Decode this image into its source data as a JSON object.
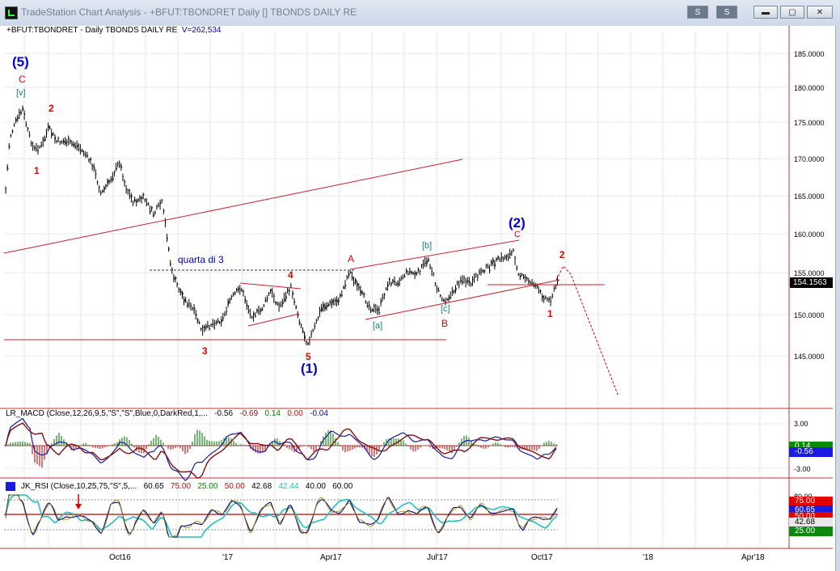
{
  "window": {
    "title": "TradeStation Chart Analysis - +BFUT:TBONDRET Daily [] TBONDS DAILY RE",
    "buttons": {
      "s_label": "S",
      "min_label": "▬",
      "max_label": "▢",
      "close_label": "✕"
    }
  },
  "chart": {
    "symbol_line": "+BFUT:TBONDRET - Daily  TBONDS DAILY RE",
    "v_value": "V=262,534",
    "last_price": "154.1563",
    "price_ticks": [
      "185.0000",
      "180.0000",
      "175.0000",
      "170.0000",
      "165.0000",
      "160.0000",
      "155.0000",
      "150.0000",
      "145.0000"
    ],
    "x_ticks": [
      "Oct16",
      "'17",
      "Apr17",
      "Jul'17",
      "Oct17",
      "'18",
      "Apr'18"
    ],
    "annotations": {
      "w5_blue": "(5)",
      "c_red_top": "C",
      "v_teal": "[v]",
      "two_red_top": "2",
      "one_red_top": "1",
      "quarta": "quarta di 3",
      "three_red": "3",
      "four_red": "4",
      "five_red": "5",
      "w1_blue": "(1)",
      "a_red": "A",
      "a_teal": "[a]",
      "b_teal": "[b]",
      "c_teal": "[c]",
      "b_red": "B",
      "w2_blue": "(2)",
      "c_red_mid": "C",
      "two_red_right": "2",
      "one_red_right": "1"
    },
    "colors": {
      "accent_blue": "#0000d0",
      "wave_red": "#e00000",
      "wave_teal": "#177e7e",
      "bars": "#000000",
      "channel": "#c8202a"
    }
  },
  "macd": {
    "label": "LR_MACD (Close,12,26,9,5,\"S\",\"S\",Blue,0,DarkRed,1,...",
    "values": {
      "v1": "-0.56",
      "v2": "-0.69",
      "v3": "0.14",
      "v4": "0.00",
      "v5": "-0.04"
    },
    "ticks": [
      "3.00",
      "-3.00"
    ],
    "badges": {
      "b1": "0.14",
      "b2": "-0.56"
    }
  },
  "rsi": {
    "label": "JK_RSI (Close,10,25,75,\"S\",5,...",
    "values": {
      "v1": "60.65",
      "v2": "75.00",
      "v3": "25.00",
      "v4": "50.00",
      "v5": "42.68",
      "v6": "42.44",
      "v7": "40.00",
      "v8": "60.00"
    },
    "ticks": [
      "80.00"
    ],
    "badges": {
      "b75": "75.00",
      "b60": "60.65",
      "b50": "50.00",
      "b42": "42.68",
      "b25": "25.00"
    }
  }
}
